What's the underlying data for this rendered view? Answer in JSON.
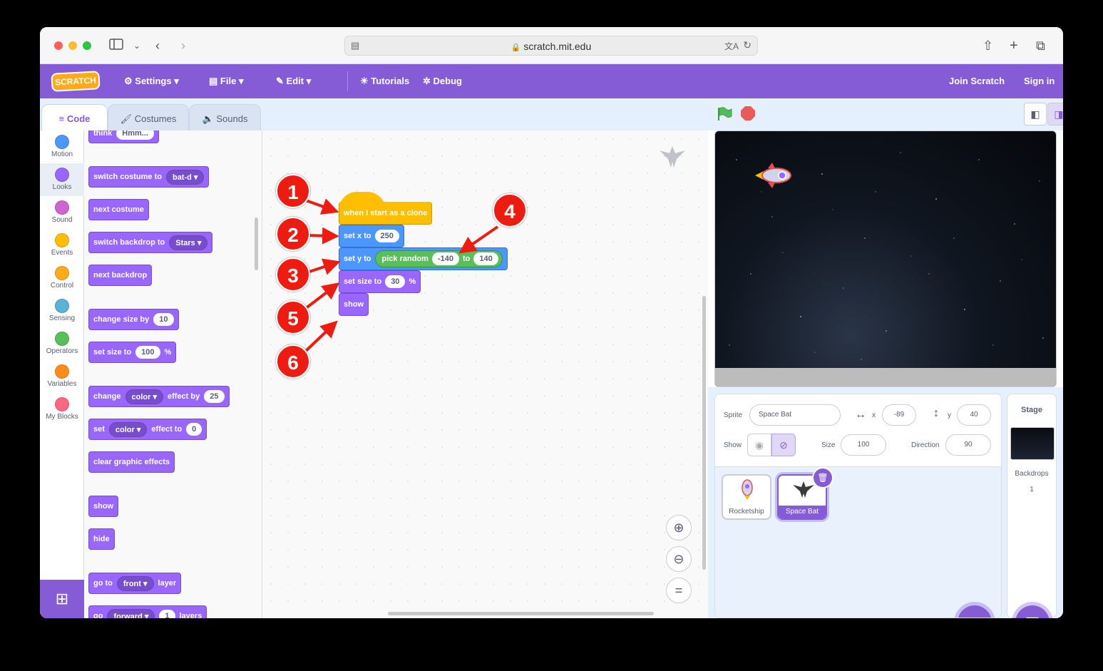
{
  "browser": {
    "url": "scratch.mit.edu",
    "traffic_colors": [
      "#ff5f57",
      "#febc2e",
      "#28c840"
    ]
  },
  "menu": {
    "logo": "SCRATCH",
    "settings": "Settings",
    "file": "File",
    "edit": "Edit",
    "tutorials": "Tutorials",
    "debug": "Debug",
    "join": "Join Scratch",
    "signin": "Sign in"
  },
  "tabs": {
    "code": "Code",
    "costumes": "Costumes",
    "sounds": "Sounds"
  },
  "categories": [
    {
      "label": "Motion",
      "color": "#4c97ff"
    },
    {
      "label": "Looks",
      "color": "#9966ff"
    },
    {
      "label": "Sound",
      "color": "#cf63cf"
    },
    {
      "label": "Events",
      "color": "#ffbf00"
    },
    {
      "label": "Control",
      "color": "#ffab19"
    },
    {
      "label": "Sensing",
      "color": "#5cb1d6"
    },
    {
      "label": "Operators",
      "color": "#59c059"
    },
    {
      "label": "Variables",
      "color": "#ff8c1a"
    },
    {
      "label": "My Blocks",
      "color": "#ff6680"
    }
  ],
  "palette": {
    "think": "think",
    "think_val": "Hmm...",
    "switch_costume": "switch costume to",
    "costume_val": "bat-d",
    "next_costume": "next costume",
    "switch_backdrop": "switch backdrop to",
    "backdrop_val": "Stars",
    "next_backdrop": "next backdrop",
    "change_size": "change size by",
    "change_size_val": "10",
    "set_size": "set size to",
    "set_size_val": "100",
    "percent": "%",
    "change_effect": "change",
    "effect_dd": "color",
    "effect_by": "effect by",
    "effect_by_val": "25",
    "set_effect": "set",
    "set_effect_dd": "color",
    "effect_to": "effect to",
    "effect_to_val": "0",
    "clear_effects": "clear graphic effects",
    "show": "show",
    "hide": "hide",
    "go_to": "go to",
    "layer_dd": "front",
    "layer": "layer",
    "go": "go",
    "forward_dd": "forward",
    "layers_val": "1",
    "layers": "layers"
  },
  "script": {
    "hat": "when I start as a clone",
    "set_x": "set x to",
    "x_val": "250",
    "set_y": "set y to",
    "pick_random": "pick random",
    "rand_min": "-140",
    "rand_to": "to",
    "rand_max": "140",
    "set_size": "set size to",
    "size_val": "30",
    "percent": "%",
    "show": "show"
  },
  "badges": [
    "1",
    "2",
    "3",
    "4",
    "5",
    "6"
  ],
  "sprite_info": {
    "sprite_label": "Sprite",
    "sprite_name": "Space Bat",
    "x_label": "x",
    "x_val": "-89",
    "y_label": "y",
    "y_val": "40",
    "show_label": "Show",
    "size_label": "Size",
    "size_val": "100",
    "direction_label": "Direction",
    "direction_val": "90"
  },
  "sprites": [
    {
      "name": "Rocketship",
      "selected": false
    },
    {
      "name": "Space Bat",
      "selected": true
    }
  ],
  "stage_panel": {
    "title": "Stage",
    "backdrops_label": "Backdrops",
    "backdrops_count": "1"
  }
}
